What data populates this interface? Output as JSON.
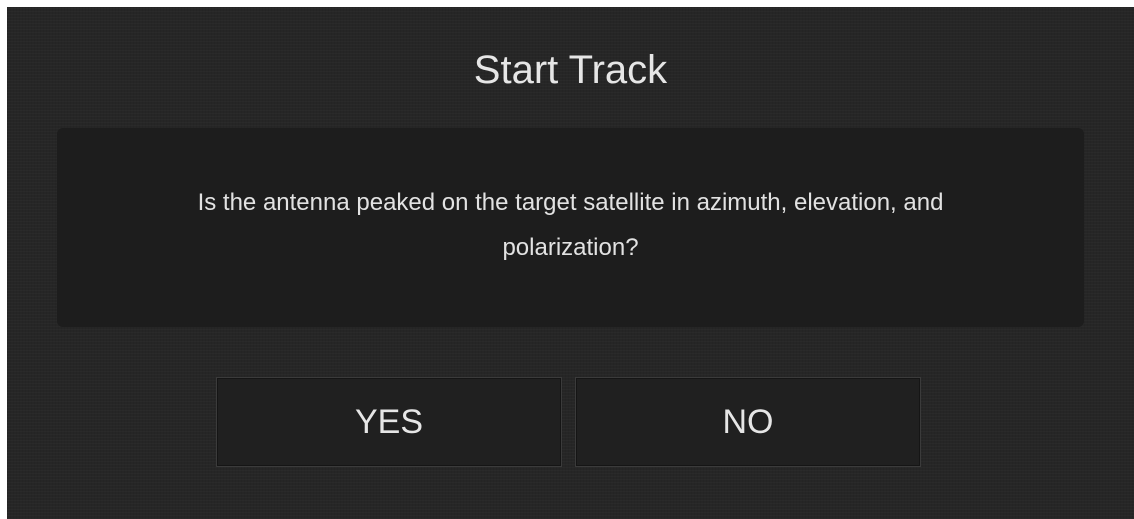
{
  "dialog": {
    "title": "Start Track",
    "message": "Is the antenna peaked on the target satellite in azimuth, elevation, and polarization?",
    "buttons": {
      "yes_label": "YES",
      "no_label": "NO"
    }
  },
  "colors": {
    "background": "#262626",
    "panel": "#1d1d1d",
    "button": "#202020",
    "text": "#e6e6e6"
  }
}
